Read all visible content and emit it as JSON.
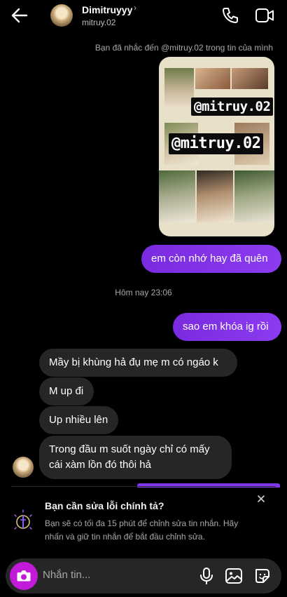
{
  "header": {
    "name": "Dimitruyyy",
    "username": "mitruy.02",
    "chevron": "›",
    "icons": [
      "back-arrow-icon",
      "phone-icon",
      "video-camera-icon"
    ]
  },
  "mention_notice": "Bạn đã nhắc đến @mitruy.02 trong tin của mình",
  "story": {
    "tag_small": "@mitruy.02",
    "tag_large": "@mitruy.02"
  },
  "messages": [
    {
      "from": "me",
      "text": "em còn nhớ hay đã quên"
    },
    {
      "from": "meta",
      "text": "Hôm nay 23:06"
    },
    {
      "from": "me",
      "text": "sao em khóa ig rồi"
    },
    {
      "from": "them",
      "text": "Mầy bị khùng hả đụ mẹ m có ngáo k"
    },
    {
      "from": "them",
      "text": "M up đi"
    },
    {
      "from": "them",
      "text": "Up nhiều lên"
    },
    {
      "from": "them",
      "text": "Trong đầu m suốt ngày chỉ có mấy cái xàm lồn đó thôi hả"
    }
  ],
  "spellcheck_tip": {
    "title": "Bạn cần sửa lỗi chính tả?",
    "body": "Bạn sẽ có tối đa 15 phút để chỉnh sửa tin nhắn. Hãy nhấn và giữ tin nhắn để bắt đầu chỉnh sửa."
  },
  "composer": {
    "placeholder": "Nhắn tin...",
    "icons": [
      "camera-icon",
      "microphone-icon",
      "gallery-icon",
      "sticker-icon"
    ]
  },
  "colors": {
    "accent": "#8b3cf0",
    "camera": "#c21ad8",
    "incoming": "#262626"
  }
}
